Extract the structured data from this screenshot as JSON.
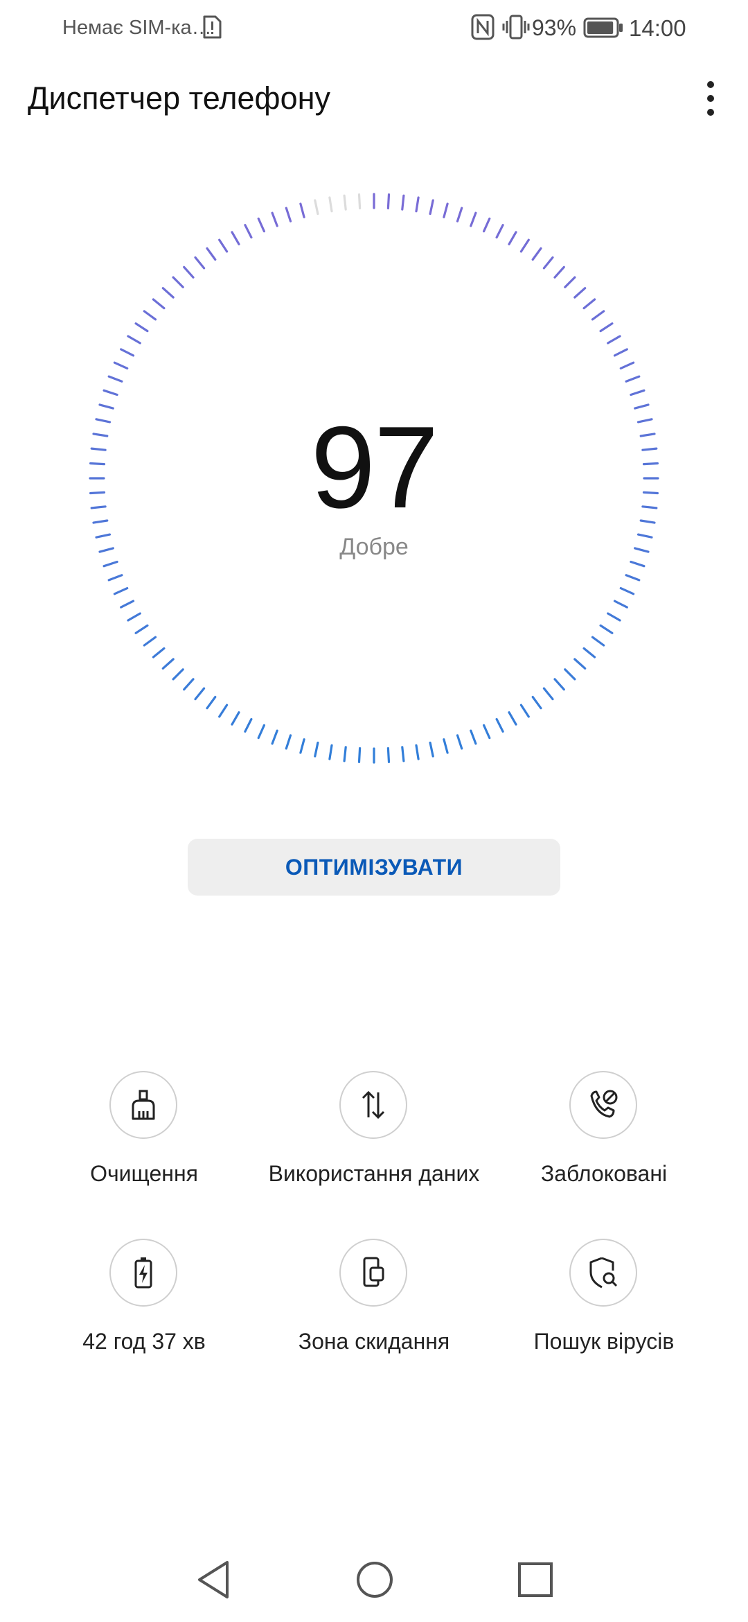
{
  "status_bar": {
    "sim_text": "Немає SIM-ка…",
    "sim_icon": "sim-alert-icon",
    "nfc_icon": "nfc-icon",
    "vibrate_icon": "vibrate-icon",
    "battery_percent": "93%",
    "battery_level": 0.93,
    "time": "14:00"
  },
  "header": {
    "title": "Диспетчер телефону",
    "menu_icon": "more-vertical-icon"
  },
  "score": {
    "value": "97",
    "label": "Добре",
    "ring_fill_fraction": 0.97,
    "ring_colors": {
      "top": "#7b6bd6",
      "bottom": "#2f7fd9",
      "unfilled": "#dcdcdc"
    }
  },
  "optimize_button": {
    "label": "ОПТИМІЗУВАТИ",
    "text_color": "#0a59b7"
  },
  "tools": [
    {
      "label": "Очищення",
      "icon": "broom-icon"
    },
    {
      "label": "Використання даних",
      "icon": "data-transfer-icon"
    },
    {
      "label": "Заблоковані",
      "icon": "blocked-call-icon"
    },
    {
      "label": "42 год 37 хв",
      "icon": "battery-charging-icon"
    },
    {
      "label": "Зона скидання",
      "icon": "dropzone-icon"
    },
    {
      "label": "Пошук вірусів",
      "icon": "virus-scan-icon"
    }
  ],
  "nav_bar": {
    "back": "back-triangle-icon",
    "home": "home-circle-icon",
    "recents": "recents-square-icon"
  }
}
